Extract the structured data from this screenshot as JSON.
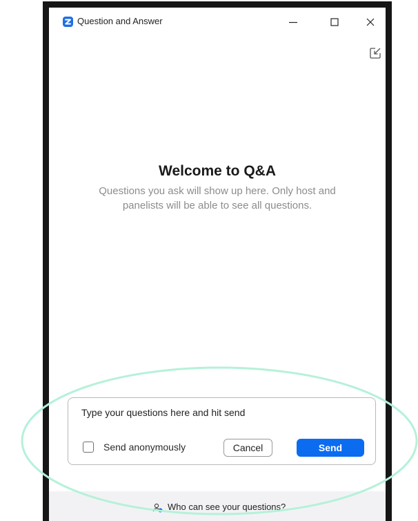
{
  "window": {
    "title": "Question and Answer",
    "app_icon": "zoom-logo-icon",
    "controls": {
      "minimize": "minimize-icon",
      "maximize": "maximize-icon",
      "close": "close-icon"
    }
  },
  "toolbar": {
    "popout_icon": "popin-arrow-icon"
  },
  "welcome": {
    "title": "Welcome to Q&A",
    "subtitle": "Questions you ask will show up here. Only host and panelists will be able to see all questions."
  },
  "compose": {
    "placeholder": "Type your questions here and hit send",
    "value": "",
    "anonymous_label": "Send anonymously",
    "anonymous_checked": false,
    "cancel_label": "Cancel",
    "send_label": "Send"
  },
  "footer": {
    "link_text": "Who can see your questions?",
    "icon": "people-icon"
  },
  "colors": {
    "accent": "#0b6cf0",
    "frame": "#161616",
    "highlight": "#b5f1d9"
  }
}
